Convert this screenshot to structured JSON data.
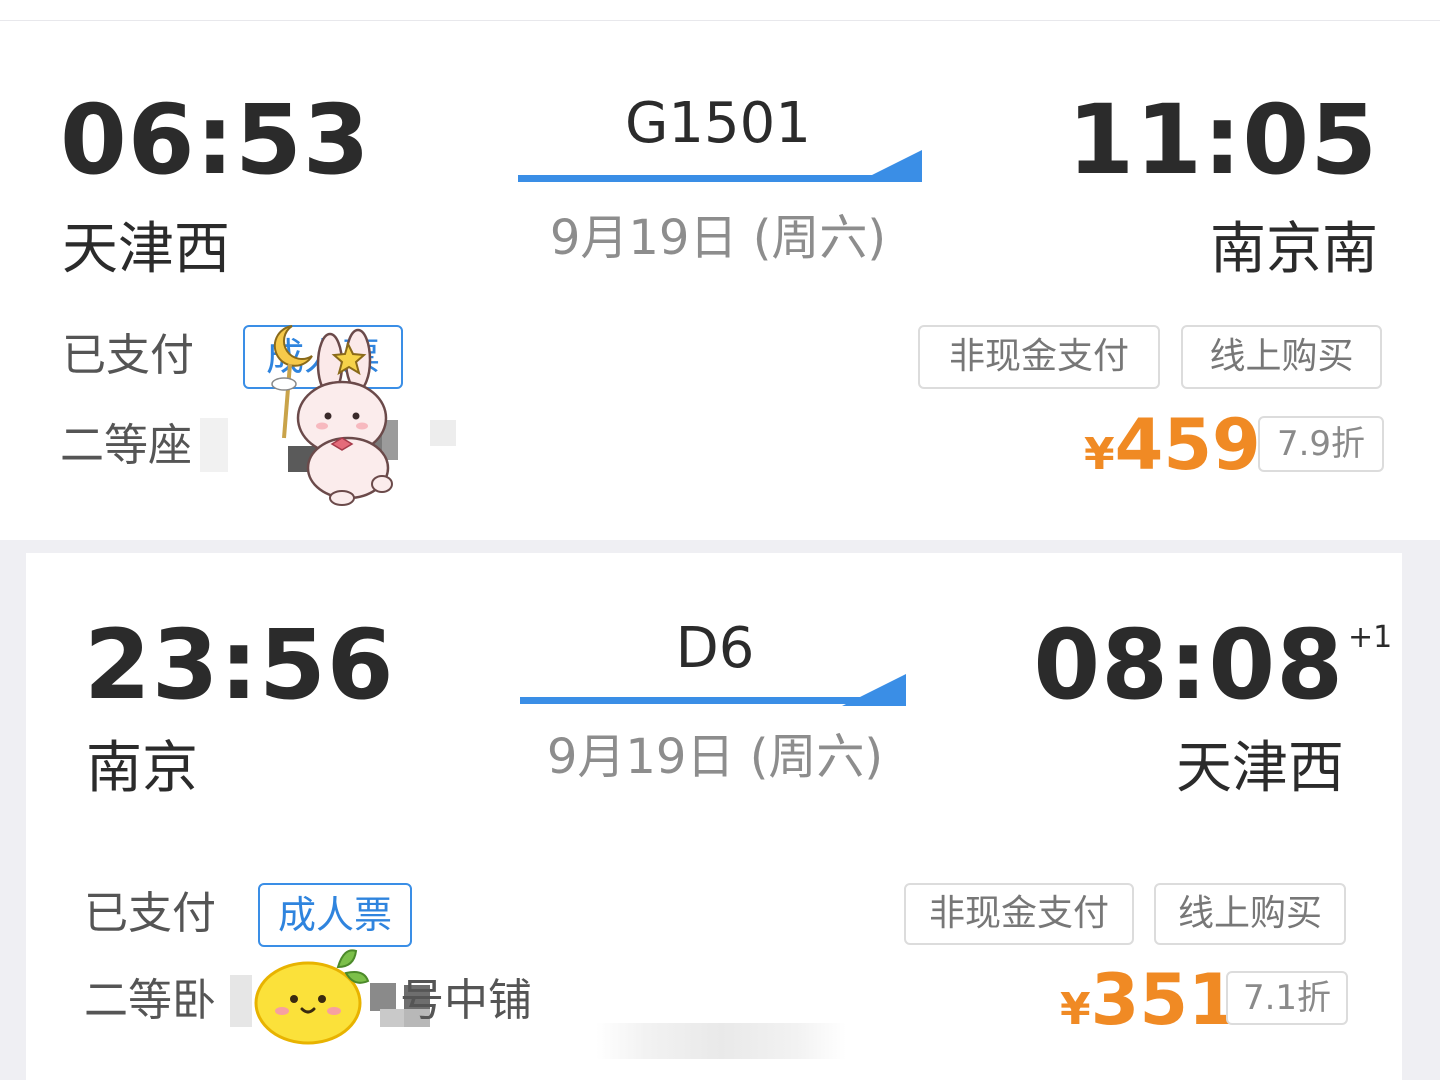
{
  "trips": [
    {
      "depart_time": "06:53",
      "depart_station": "天津西",
      "train_no": "G1501",
      "date": "9月19日 (周六)",
      "arrive_time": "11:05",
      "arrive_station": "南京南",
      "arrive_day_offset": "",
      "status": "已支付",
      "ticket_type": "成人票",
      "seat_class": "二等座",
      "seat_detail": "",
      "pay_tag": "非现金支付",
      "channel_tag": "线上购买",
      "currency": "¥",
      "price": "459",
      "discount": "7.9折"
    },
    {
      "depart_time": "23:56",
      "depart_station": "南京",
      "train_no": "D6",
      "date": "9月19日 (周六)",
      "arrive_time": "08:08",
      "arrive_station": "天津西",
      "arrive_day_offset": "+1",
      "status": "已支付",
      "ticket_type": "成人票",
      "seat_class": "二等卧",
      "seat_detail": "号中铺",
      "pay_tag": "非现金支付",
      "channel_tag": "线上购买",
      "currency": "¥",
      "price": "351",
      "discount": "7.1折"
    }
  ],
  "colors": {
    "accent_blue": "#3a8ee6",
    "price_orange": "#f08a24",
    "text_dark": "#2b2b2b",
    "text_gray": "#8d8d8d"
  },
  "icons": [
    "arrow-right-icon",
    "bunny-sticker-icon",
    "lemon-sticker-icon"
  ]
}
